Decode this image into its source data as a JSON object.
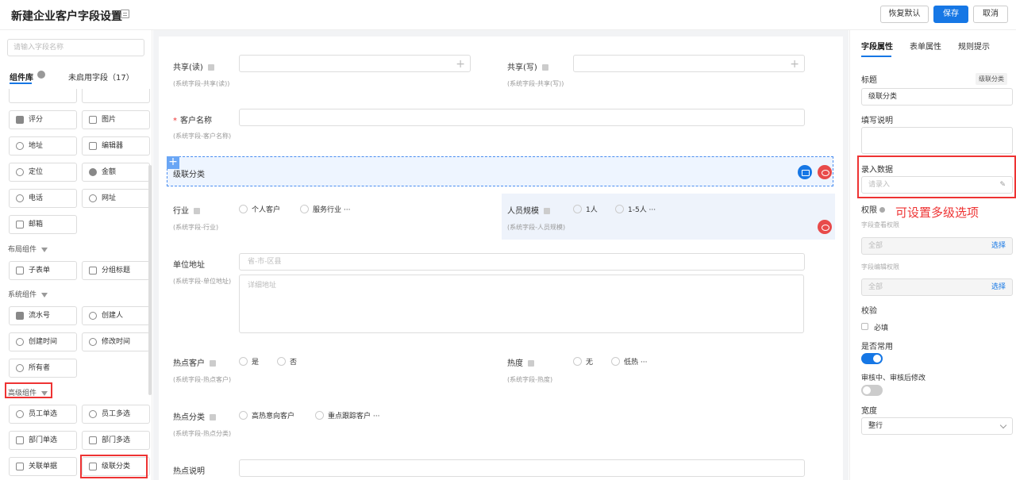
{
  "header": {
    "title": "新建企业客户字段设置",
    "restore_label": "恢复默认",
    "save_label": "保存",
    "cancel_label": "取消"
  },
  "left": {
    "search_placeholder": "请输入字段名称",
    "tab_library": "组件库",
    "tab_unused": "未启用字段（17）",
    "components_top": [
      {
        "label": "评分",
        "icon": "star-icon"
      },
      {
        "label": "图片",
        "icon": "image-icon"
      },
      {
        "label": "地址",
        "icon": "location-icon"
      },
      {
        "label": "编辑器",
        "icon": "editor-icon"
      },
      {
        "label": "定位",
        "icon": "pin-icon"
      },
      {
        "label": "金额",
        "icon": "money-icon"
      },
      {
        "label": "电话",
        "icon": "phone-icon"
      },
      {
        "label": "网址",
        "icon": "globe-icon"
      },
      {
        "label": "邮箱",
        "icon": "mail-icon"
      }
    ],
    "group_layout": "布局组件",
    "layout_components": [
      {
        "label": "子表单",
        "icon": "table-icon"
      },
      {
        "label": "分组标题",
        "icon": "list-icon"
      }
    ],
    "group_system": "系统组件",
    "system_components": [
      {
        "label": "流水号",
        "icon": "serial-icon"
      },
      {
        "label": "创建人",
        "icon": "user-icon"
      },
      {
        "label": "创建时间",
        "icon": "clock-icon"
      },
      {
        "label": "修改时间",
        "icon": "edit-clock-icon"
      },
      {
        "label": "所有者",
        "icon": "owner-icon"
      }
    ],
    "group_advanced": "高级组件",
    "advanced_components": [
      {
        "label": "员工单选",
        "icon": "user-icon"
      },
      {
        "label": "员工多选",
        "icon": "users-icon"
      },
      {
        "label": "部门单选",
        "icon": "org-icon"
      },
      {
        "label": "部门多选",
        "icon": "org-multi-icon"
      },
      {
        "label": "关联单据",
        "icon": "link-doc-icon"
      },
      {
        "label": "级联分类",
        "icon": "cascade-icon"
      }
    ]
  },
  "canvas": {
    "share_read_label": "共享(读)",
    "share_read_sub": "(系统字段-共享(读))",
    "share_write_label": "共享(写)",
    "share_write_sub": "(系统字段-共享(写))",
    "customer_name_label": "客户名称",
    "customer_name_sub": "(系统字段-客户名称)",
    "cascade_label": "级联分类",
    "industry_label": "行业",
    "industry_sub": "(系统字段-行业)",
    "industry_options": [
      "个人客户",
      "服务行业 ···"
    ],
    "staff_size_label": "人员规模",
    "staff_size_sub": "(系统字段-人员规模)",
    "staff_size_options": [
      "1人",
      "1-5人 ···"
    ],
    "address_label": "单位地址",
    "address_sub": "(系统字段-单位地址)",
    "address_placeholder": "省-市-区县",
    "address_detail_placeholder": "详细地址",
    "hot_customer_label": "热点客户",
    "hot_customer_sub": "(系统字段-热点客户)",
    "hot_customer_options": [
      "是",
      "否"
    ],
    "heat_label": "热度",
    "heat_sub": "(系统字段-热度)",
    "heat_options": [
      "无",
      "低热 ···"
    ],
    "hot_category_label": "热点分类",
    "hot_category_sub": "(系统字段-热点分类)",
    "hot_category_options": [
      "高热意向客户",
      "重点跟踪客户 ···"
    ],
    "hot_desc_label": "热点说明"
  },
  "right": {
    "tab_field": "字段属性",
    "tab_form": "表单属性",
    "tab_rules": "规则提示",
    "title_label": "标题",
    "title_tag": "级联分类",
    "title_value": "级联分类",
    "desc_label": "填写说明",
    "input_data_label": "录入数据",
    "input_data_placeholder": "请录入",
    "permission_label": "权限",
    "view_perm_label": "字段查看权限",
    "view_perm_value": "全部",
    "select_label": "选择",
    "edit_perm_label": "字段编辑权限",
    "edit_perm_value": "全部",
    "validation_label": "校验",
    "required_label": "必填",
    "common_label": "是否常用",
    "audit_label": "审核中、审核后修改",
    "width_label": "宽度",
    "width_value": "整行"
  },
  "annotation": "可设置多级选项",
  "colors": {
    "primary": "#1677e5",
    "highlight_red": "#e33333",
    "delete_red": "#e84a4a"
  }
}
